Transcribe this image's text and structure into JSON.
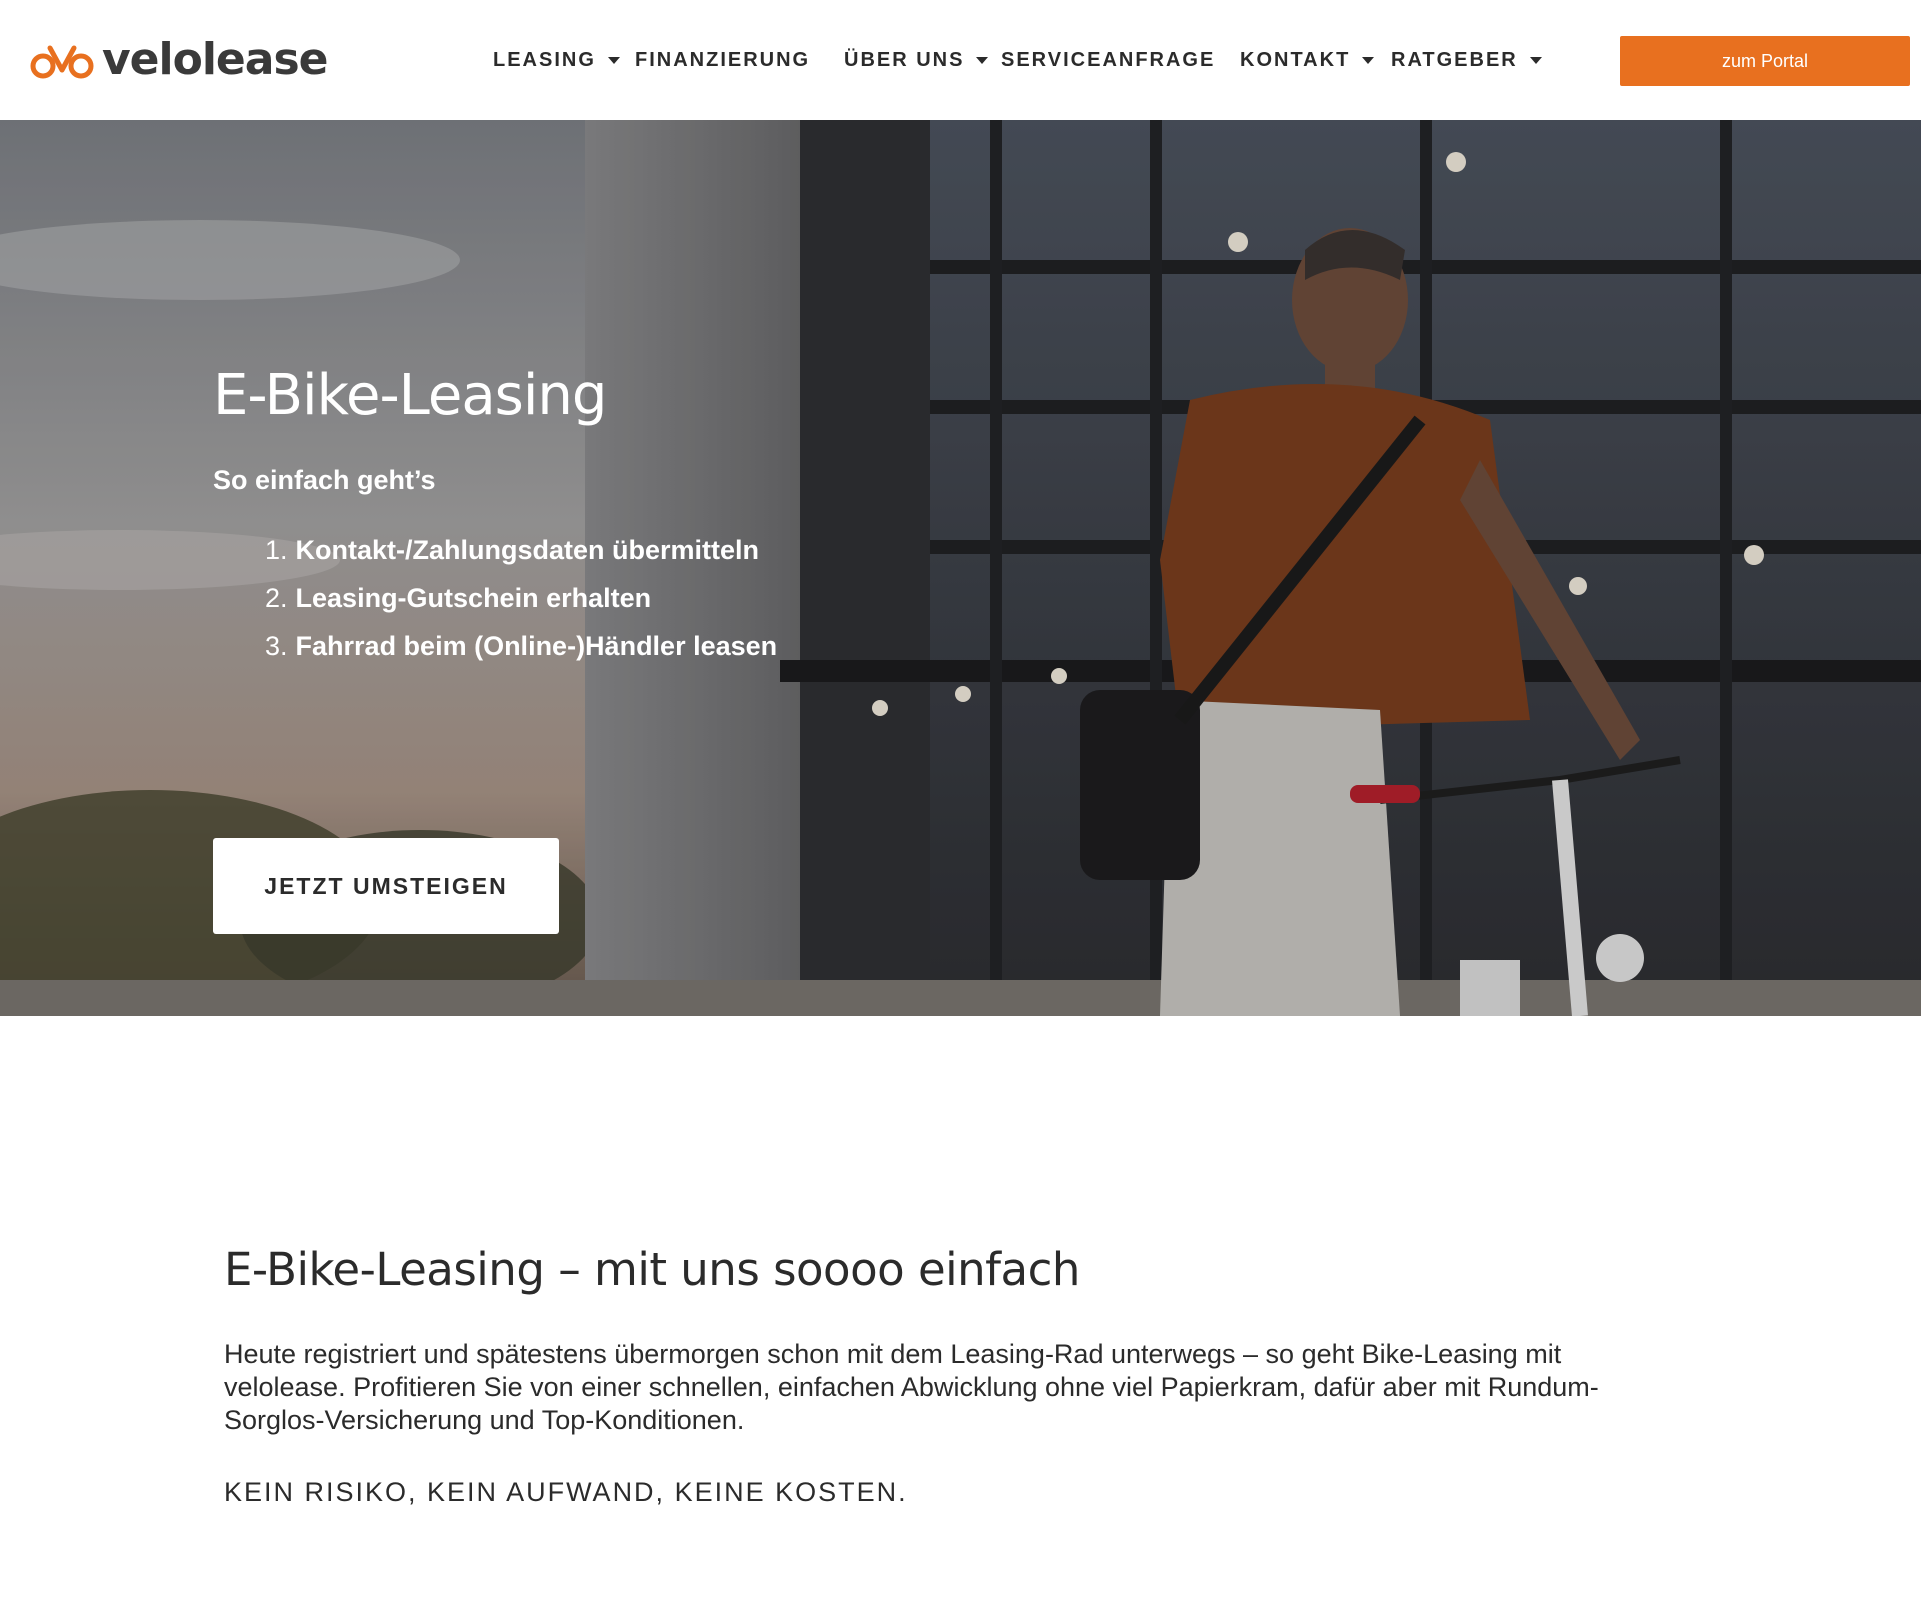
{
  "brand": {
    "name": "velolease",
    "accent_color": "#e8701f",
    "logo_icon": "bicycle-logo-icon"
  },
  "nav": {
    "items": [
      {
        "label": "LEASING",
        "has_dropdown": true
      },
      {
        "label": "FINANZIERUNG",
        "has_dropdown": false
      },
      {
        "label": "ÜBER UNS",
        "has_dropdown": true
      },
      {
        "label": "SERVICEANFRAGE",
        "has_dropdown": false
      },
      {
        "label": "KONTAKT",
        "has_dropdown": true
      },
      {
        "label": "RATGEBER",
        "has_dropdown": true
      }
    ],
    "portal_button": "zum Portal"
  },
  "hero": {
    "title": "E-Bike-Leasing",
    "subtitle": "So einfach geht’s",
    "steps": [
      {
        "num": "1.",
        "text": "Kontakt-/Zahlungsdaten übermitteln"
      },
      {
        "num": "2.",
        "text": "Leasing-Gutschein erhalten"
      },
      {
        "num": "3.",
        "text": "Fahrrad beim (Online-)Händler leasen"
      }
    ],
    "cta": "JETZT UMSTEIGEN"
  },
  "intro": {
    "title": "E-Bike-Leasing – mit uns soooo einfach",
    "text": "Heute registriert und spätestens übermorgen schon mit dem Leasing-Rad unterwegs – so geht Bike-Leasing mit velolease. Profitieren Sie von einer schnellen, einfachen Abwicklung ohne viel Papierkram, dafür aber mit Rundum-Sorglos-Versicherung und Top-Konditionen.",
    "tagline": "KEIN RISIKO, KEIN AUFWAND, KEINE KOSTEN."
  }
}
